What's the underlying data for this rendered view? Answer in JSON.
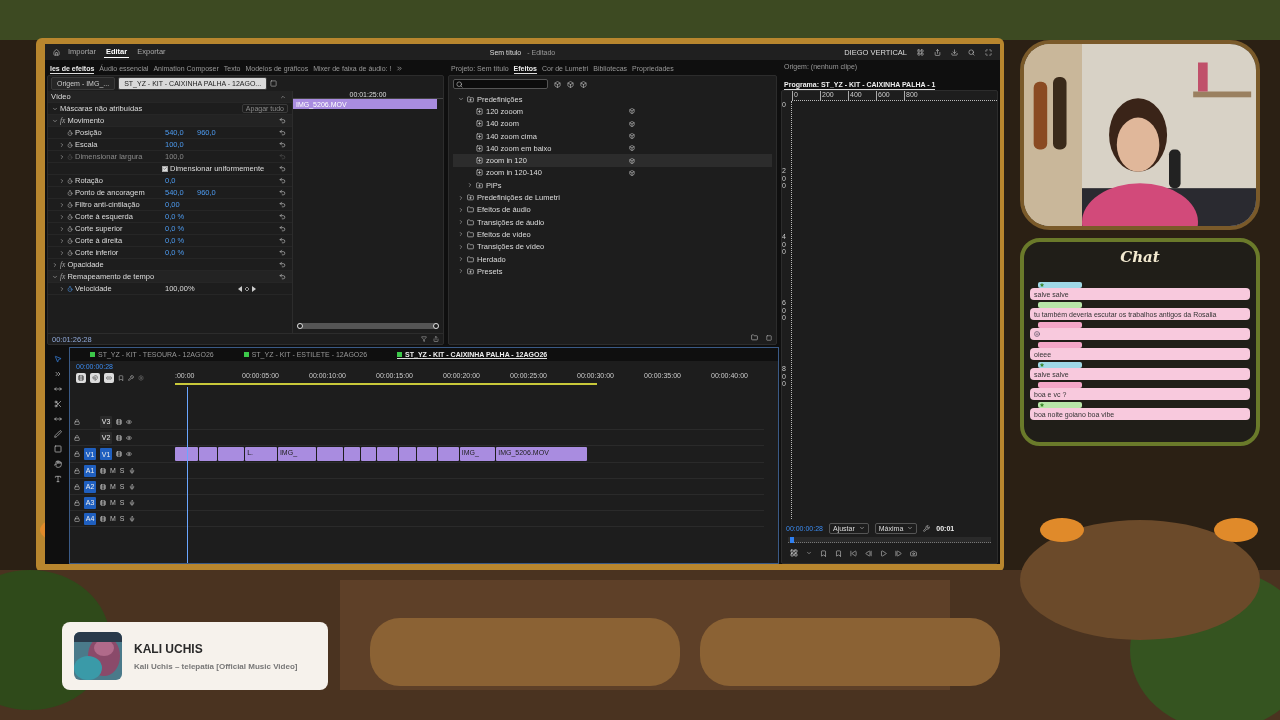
{
  "topbar": {
    "nav": [
      {
        "label": "Importar",
        "selected": false
      },
      {
        "label": "Editar",
        "selected": true
      },
      {
        "label": "Exportar",
        "selected": false
      }
    ],
    "title": "Sem título",
    "status": "- Editado",
    "workspace": "DIEGO VERTICAL"
  },
  "panel_tabs": [
    {
      "label": "les de efeitos",
      "selected": true
    },
    {
      "label": "Áudio essencial",
      "selected": false
    },
    {
      "label": "Animation Composer",
      "selected": false
    },
    {
      "label": "Texto",
      "selected": false
    },
    {
      "label": "Modelos de gráficos",
      "selected": false
    },
    {
      "label": "Mixer de faixa de áudio: !",
      "selected": false
    }
  ],
  "effect_controls": {
    "sources": [
      {
        "label": "Origem - IMG_...",
        "selected": false
      },
      {
        "label": "ST_YZ - KIT - CAIXINHA PALHA  - 12AGO...",
        "selected": true
      }
    ],
    "rows": [
      {
        "kind": "header",
        "label": "Vídeo"
      },
      {
        "kind": "group",
        "label": "Máscaras não atribuídas",
        "expanded": true,
        "button": "Apagar tudo"
      },
      {
        "kind": "fx",
        "badge": "fx",
        "label": "Movimento",
        "expanded": true
      },
      {
        "kind": "prop",
        "label": "Posição",
        "values": [
          "540,0",
          "960,0"
        ],
        "expandable": false,
        "disabled": false
      },
      {
        "kind": "prop",
        "label": "Escala",
        "values": [
          "100,0"
        ],
        "expandable": true,
        "disabled": false
      },
      {
        "kind": "prop",
        "label": "Dimensionar largura",
        "values": [
          "100,0"
        ],
        "expandable": true,
        "disabled": true
      },
      {
        "kind": "check",
        "label": "Dimensionar uniformemente",
        "checked": true
      },
      {
        "kind": "prop",
        "label": "Rotação",
        "values": [
          "0,0"
        ],
        "expandable": true,
        "disabled": false
      },
      {
        "kind": "prop",
        "label": "Ponto de ancoragem",
        "values": [
          "540,0",
          "960,0"
        ],
        "expandable": false,
        "disabled": false
      },
      {
        "kind": "prop",
        "label": "Filtro anti-cintilação",
        "values": [
          "0,00"
        ],
        "expandable": true,
        "disabled": false
      },
      {
        "kind": "prop",
        "label": "Corte à esquerda",
        "values": [
          "0,0 %"
        ],
        "expandable": true,
        "disabled": false
      },
      {
        "kind": "prop",
        "label": "Corte superior",
        "values": [
          "0,0 %"
        ],
        "expandable": true,
        "disabled": false
      },
      {
        "kind": "prop",
        "label": "Corte à direita",
        "values": [
          "0,0 %"
        ],
        "expandable": true,
        "disabled": false
      },
      {
        "kind": "prop",
        "label": "Corte inferior",
        "values": [
          "0,0 %"
        ],
        "expandable": true,
        "disabled": false
      },
      {
        "kind": "fx",
        "badge": "fx",
        "label": "Opacidade",
        "expanded": false
      },
      {
        "kind": "fx",
        "badge": "fx",
        "label": "Remapeamento de tempo",
        "expanded": true
      },
      {
        "kind": "speed",
        "label": "Velocidade",
        "values": [
          "100,00%"
        ],
        "expandable": true
      }
    ],
    "ruler_time": "00:01:25:00",
    "clip": "IMG_5206.MOV",
    "zoom_bar": {
      "level": 1
    },
    "footer_time": "00:01:26:28"
  },
  "effects": {
    "tabs": [
      {
        "label": "Projeto: Sem título",
        "selected": false
      },
      {
        "label": "Efeitos",
        "selected": true
      },
      {
        "label": "Cor de Lumetri",
        "selected": false
      },
      {
        "label": "Bibliotecas",
        "selected": false
      },
      {
        "label": "Propriedades",
        "selected": false
      }
    ],
    "tree": [
      {
        "kind": "preset-folder",
        "label": "Predefinições",
        "expanded": true,
        "children": [
          {
            "kind": "preset",
            "label": "120 zooom",
            "selected": false
          },
          {
            "kind": "preset",
            "label": "140 zoom",
            "selected": false
          },
          {
            "kind": "preset",
            "label": "140 zoom cima",
            "selected": false
          },
          {
            "kind": "preset",
            "label": "140 zoom em baixo",
            "selected": false
          },
          {
            "kind": "preset",
            "label": "zoom in 120",
            "selected": true
          },
          {
            "kind": "preset",
            "label": "zoom in 120-140",
            "selected": false
          },
          {
            "kind": "preset-folder",
            "label": "PiPs",
            "expanded": false
          }
        ]
      },
      {
        "kind": "preset-folder",
        "label": "Predefinições de Lumetri",
        "expanded": false
      },
      {
        "kind": "folder",
        "label": "Efeitos de áudio",
        "expanded": false
      },
      {
        "kind": "folder",
        "label": "Transições de áudio",
        "expanded": false
      },
      {
        "kind": "folder",
        "label": "Efeitos de vídeo",
        "expanded": false
      },
      {
        "kind": "folder",
        "label": "Transições de vídeo",
        "expanded": false
      },
      {
        "kind": "folder",
        "label": "Herdado",
        "expanded": false
      },
      {
        "kind": "preset-folder",
        "label": "Presets",
        "expanded": false
      }
    ]
  },
  "program": {
    "tabs": [
      {
        "label": "Origem: (nenhum clipe)",
        "selected": false
      },
      {
        "label": "Programa: ST_YZ - KIT - CAIXINHA PALHA  - 1",
        "selected": true
      }
    ],
    "hruler": [
      "0",
      "200",
      "400",
      "600",
      "800"
    ],
    "vruler": [
      "0",
      "200",
      "400",
      "600",
      "800"
    ],
    "timecode": "00:00:00:28",
    "fit": "Ajustar",
    "quality": "Máxima",
    "duration": "00:01",
    "scrubber": {
      "level": 0.01
    }
  },
  "timeline": {
    "sequences": [
      {
        "label": "ST_YZ - KIT - TESOURA  - 12AGO26",
        "selected": false
      },
      {
        "label": "ST_YZ - KIT - ESTILETE  - 12AGO26",
        "selected": false
      },
      {
        "label": "ST_YZ - KIT - CAIXINHA PALHA  - 12AGO26",
        "selected": true
      }
    ],
    "timecode": "00:00:00:28",
    "ruler": [
      ":00:00",
      "00:00:05:00",
      "00:00:10:00",
      "00:00:15:00",
      "00:00:20:00",
      "00:00:25:00",
      "00:00:30:00",
      "00:00:35:00",
      "00:00:40:00"
    ],
    "playhead": {
      "level": 0.02
    },
    "tracks": [
      {
        "kind": "video",
        "label": "V3",
        "targeted": false
      },
      {
        "kind": "video",
        "label": "V2",
        "targeted": false
      },
      {
        "kind": "video",
        "label": "V1",
        "source": "V1",
        "targeted": true
      },
      {
        "kind": "audio",
        "label": "A1",
        "targeted": true,
        "mute": "M",
        "solo": "S"
      },
      {
        "kind": "audio",
        "label": "A2",
        "targeted": true,
        "mute": "M",
        "solo": "S"
      },
      {
        "kind": "audio",
        "label": "A3",
        "targeted": true,
        "mute": "M",
        "solo": "S"
      },
      {
        "kind": "audio",
        "label": "A4",
        "targeted": true,
        "mute": "M",
        "solo": "S"
      }
    ],
    "clips": [
      {
        "kind": "clip"
      },
      {
        "kind": "clip"
      },
      {
        "kind": "clip"
      },
      {
        "kind": "clip",
        "label": "L."
      },
      {
        "kind": "clip",
        "label": "IMG_"
      },
      {
        "kind": "clip"
      },
      {
        "kind": "clip"
      },
      {
        "kind": "clip"
      },
      {
        "kind": "clip"
      },
      {
        "kind": "clip"
      },
      {
        "kind": "clip"
      },
      {
        "kind": "clip"
      },
      {
        "kind": "clip",
        "label": "IMG_"
      },
      {
        "kind": "clip",
        "label": "IMG_5206.MOV"
      }
    ]
  },
  "chat": {
    "title": "Chat",
    "messages": [
      {
        "color": "#9fd8e6",
        "badge": true,
        "kind": "text",
        "text": "salve salve"
      },
      {
        "color": "#b8e6a8",
        "badge": false,
        "kind": "text",
        "text": "tu também deveria escutar os trabalhos antigos da Rosalia"
      },
      {
        "color": "#f4a6c8",
        "badge": false,
        "kind": "emote"
      },
      {
        "color": "#f4a6c8",
        "badge": false,
        "kind": "text",
        "text": "oieee"
      },
      {
        "color": "#9fd8e6",
        "badge": true,
        "kind": "text",
        "text": "salve salve"
      },
      {
        "color": "#f4a6c8",
        "badge": false,
        "kind": "text",
        "text": "boa e vc ?"
      },
      {
        "color": "#b8e6a8",
        "badge": true,
        "kind": "text",
        "text": "boa noite goiano boa vibe"
      }
    ]
  },
  "now_playing": {
    "artist": "KALI UCHIS",
    "title": "Kali Uchis – telepatía [Official Music Video]"
  }
}
